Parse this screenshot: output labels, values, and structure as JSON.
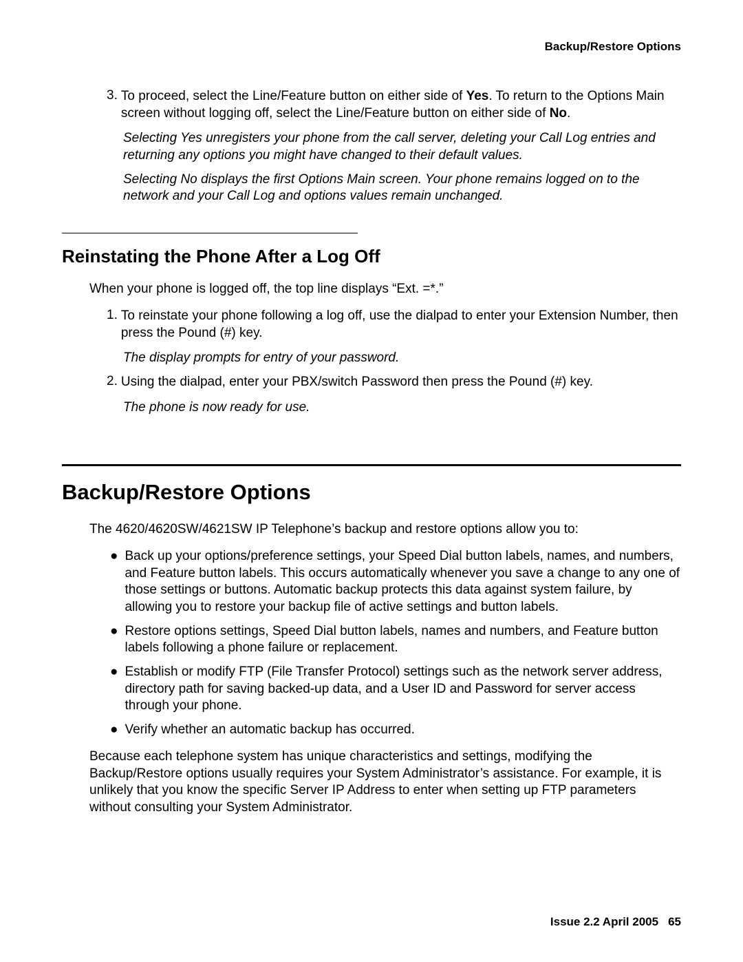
{
  "header": {
    "title": "Backup/Restore Options"
  },
  "step3": {
    "num": "3.",
    "text_before_yes": "To proceed, select the Line/Feature button on either side of ",
    "yes": "Yes",
    "text_mid": ". To return to the Options Main screen without logging off, select the Line/Feature button on either side of ",
    "no": "No",
    "text_after": ".",
    "note_yes": "Selecting Yes unregisters your phone from the call server, deleting your Call Log entries and returning any options you might have changed to their default values.",
    "note_no": "Selecting No displays the first Options Main screen. Your phone remains logged on to the network and your Call Log and options values remain unchanged."
  },
  "reinstate": {
    "heading": "Reinstating the Phone After a Log Off",
    "intro": "When your phone is logged off, the top line displays “Ext. =*.”",
    "step1": {
      "num": "1.",
      "text": "To reinstate your phone following a log off, use the dialpad to enter your Extension Number, then press the Pound (#) key.",
      "note": "The display prompts for entry of your password."
    },
    "step2": {
      "num": "2.",
      "text": "Using the dialpad, enter your PBX/switch Password then press the Pound (#) key.",
      "note": "The phone is now ready for use."
    }
  },
  "backup": {
    "heading": "Backup/Restore Options",
    "intro": "The 4620/4620SW/4621SW IP Telephone’s backup and restore options allow you to:",
    "bullets": [
      "Back up your options/preference settings, your Speed Dial button labels, names, and numbers, and Feature button labels. This occurs automatically whenever you save a change to any one of those settings or buttons. Automatic backup protects this data against system failure, by allowing you to restore your backup file of active settings and button labels.",
      "Restore options settings, Speed Dial button labels, names and numbers, and Feature button labels following a phone failure or replacement.",
      "Establish or modify FTP (File Transfer Protocol) settings such as the network server address, directory path for saving backed-up data, and a User ID and Password for server access through your phone.",
      "Verify whether an automatic backup has occurred."
    ],
    "closing": "Because each telephone system has unique characteristics and settings, modifying the Backup/Restore options usually requires your System Administrator’s assistance. For example, it is unlikely that you know the specific Server IP Address to enter when setting up FTP parameters without consulting your System Administrator."
  },
  "footer": {
    "issue": "Issue 2.2   April 2005",
    "page": "65"
  }
}
